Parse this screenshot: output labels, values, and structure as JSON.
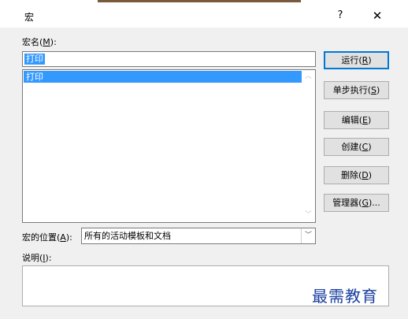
{
  "dialog": {
    "title": "宏",
    "help": "?",
    "close": "✕"
  },
  "macro_name": {
    "label_prefix": "宏名(",
    "label_key": "M",
    "label_suffix": "):",
    "value": "打印"
  },
  "macro_list": {
    "items": [
      "打印"
    ],
    "scroll_up": "︿",
    "scroll_down": "﹀"
  },
  "buttons": {
    "run": {
      "prefix": "运行(",
      "key": "R",
      "suffix": ")"
    },
    "step": {
      "prefix": "单步执行(",
      "key": "S",
      "suffix": ")"
    },
    "edit": {
      "prefix": "编辑(",
      "key": "E",
      "suffix": ")"
    },
    "create": {
      "prefix": "创建(",
      "key": "C",
      "suffix": ")"
    },
    "delete": {
      "prefix": "删除(",
      "key": "D",
      "suffix": ")"
    },
    "organizer": {
      "prefix": "管理器(",
      "key": "G",
      "suffix": ")..."
    }
  },
  "macro_location": {
    "label_prefix": "宏的位置(",
    "label_key": "A",
    "label_suffix": "):",
    "value": "所有的活动模板和文档",
    "dropdown": "﹀"
  },
  "description": {
    "label_prefix": "说明(",
    "label_key": "I",
    "label_suffix": "):",
    "value": ""
  },
  "watermark": "最需教育",
  "colors": {
    "selection": "#3399ff",
    "default_button_border": "#0078d7",
    "watermark": "#1a3fa0"
  }
}
